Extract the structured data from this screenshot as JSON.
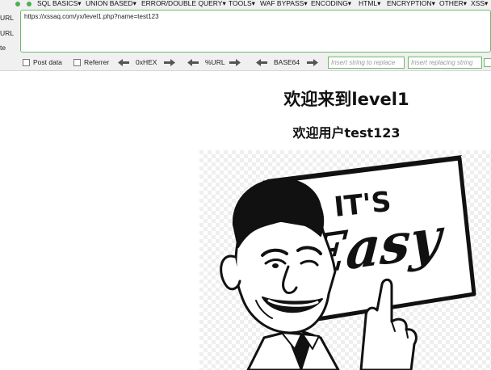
{
  "hackbar": {
    "menu": [
      "SQL BASICS▾",
      "UNION BASED▾",
      "ERROR/DOUBLE QUERY▾",
      "TOOLS▾",
      "WAF BYPASS▾",
      "ENCODING▾",
      "HTML▾",
      "ENCRYPTION▾",
      "OTHER▾",
      "XSS▾"
    ],
    "side_labels": [
      "URL",
      "URL",
      "te"
    ],
    "url_value": "https://xssaq.com/yx/level1.php?name=test123",
    "options": {
      "post_data": "Post data",
      "referrer": "Referrer",
      "hex": "0xHEX",
      "url": "%URL",
      "base64": "BASE64"
    },
    "replace_placeholder": "Insert string to replace",
    "replacing_placeholder": "Insert replacing string",
    "colors": {
      "accent_green": "#6fb96f",
      "menu_dot_green": "#4caf50",
      "menu_dot_red": "#e53935"
    }
  },
  "page": {
    "heading": "欢迎来到level1",
    "greeting": "欢迎用户test123",
    "image_sign_top": "IT'S",
    "image_sign_bottom": "Easy"
  }
}
